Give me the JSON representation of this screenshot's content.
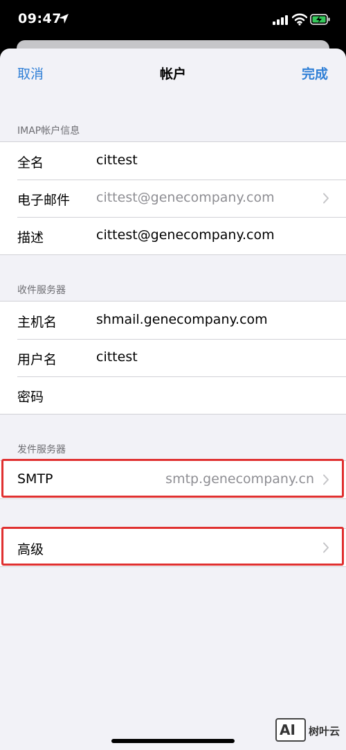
{
  "status_bar": {
    "time": "09:47"
  },
  "nav": {
    "cancel_label": "取消",
    "title": "帐户",
    "done_label": "完成"
  },
  "imap_section": {
    "header": "IMAP帐户信息",
    "rows": [
      {
        "label": "全名",
        "value": "cittest"
      },
      {
        "label": "电子邮件",
        "value": "cittest@genecompany.com"
      },
      {
        "label": "描述",
        "value": "cittest@genecompany.com"
      }
    ]
  },
  "incoming_section": {
    "header": "收件服务器",
    "rows": [
      {
        "label": "主机名",
        "value": "shmail.genecompany.com"
      },
      {
        "label": "用户名",
        "value": "cittest"
      },
      {
        "label": "密码",
        "value": ""
      }
    ]
  },
  "outgoing_section": {
    "header": "发件服务器",
    "smtp": {
      "label": "SMTP",
      "value": "smtp.genecompany.cn"
    }
  },
  "advanced": {
    "label": "高级"
  },
  "watermark": {
    "logo_text": "AI",
    "text": "树叶云"
  },
  "colors": {
    "accent": "#2f7fd6",
    "highlight": "#e03030",
    "background": "#f2f2f7"
  }
}
